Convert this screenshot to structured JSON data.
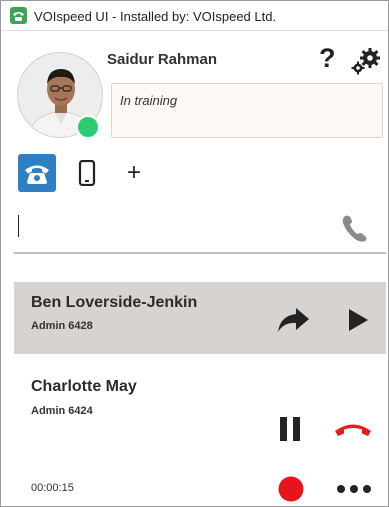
{
  "window": {
    "title": "VOIspeed UI - Installed by: VOIspeed Ltd."
  },
  "profile": {
    "name": "Saidur Rahman",
    "status_message": "In training",
    "presence_color": "#2ecc71"
  },
  "toolbar": {
    "help_label": "?",
    "add_label": "+"
  },
  "dialer": {
    "value": "",
    "placeholder": ""
  },
  "calls": [
    {
      "name": "Ben Loverside-Jenkin",
      "extension": "Admin 6428",
      "state": "held"
    },
    {
      "name": "Charlotte May",
      "extension": "Admin 6424",
      "timer": "00:00:15",
      "state": "active"
    }
  ],
  "colors": {
    "accent": "#2f7fc4",
    "hangup": "#e02020",
    "record": "#e8141c",
    "held_background": "#d6d3d1"
  },
  "icons": {
    "app": "phone-app-icon",
    "help": "question-icon",
    "settings": "gears-icon",
    "desk_phone": "desk-phone-icon",
    "mobile": "mobile-phone-icon",
    "add": "plus-icon",
    "call": "handset-icon",
    "transfer": "forward-arrow-icon",
    "resume": "play-icon",
    "hold": "pause-icon",
    "hangup": "hangup-icon",
    "record": "record-icon",
    "more": "more-dots-icon"
  }
}
